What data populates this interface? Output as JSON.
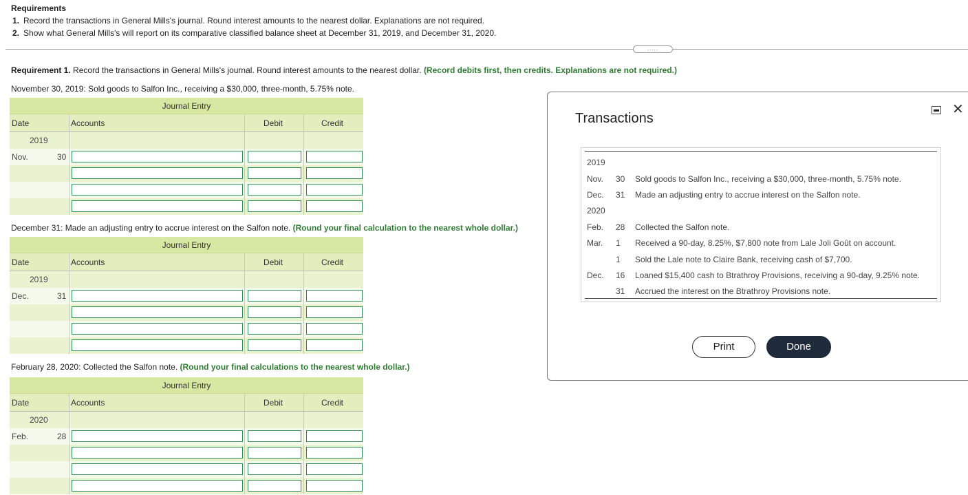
{
  "requirements": {
    "title": "Requirements",
    "items": [
      {
        "num": "1.",
        "text": "Record the transactions in General Mills's journal. Round interest amounts to the nearest dollar. Explanations are not required."
      },
      {
        "num": "2.",
        "text": "Show what General Mills's will report on its comparative classified balance sheet at December 31, 2019, and December 31, 2020."
      }
    ]
  },
  "divider_handle": ".....",
  "requirement1": {
    "label": "Requirement 1.",
    "text": " Record the transactions in General Mills's journal. Round interest amounts to the nearest dollar. ",
    "hint": "(Record debits first, then credits. Explanations are not required.)"
  },
  "sections": [
    {
      "prompt": "November 30, 2019: Sold goods to Salfon Inc., receiving a $30,000, three-month, 5.75% note.",
      "hint": "",
      "journal_title": "Journal Entry",
      "headers": {
        "date": "Date",
        "accounts": "Accounts",
        "debit": "Debit",
        "credit": "Credit"
      },
      "year": "2019",
      "month": "Nov.",
      "day": "30"
    },
    {
      "prompt": "December 31: Made an adjusting entry to accrue interest on the Salfon note. ",
      "hint": "(Round your final calculation to the nearest whole dollar.)",
      "journal_title": "Journal Entry",
      "headers": {
        "date": "Date",
        "accounts": "Accounts",
        "debit": "Debit",
        "credit": "Credit"
      },
      "year": "2019",
      "month": "Dec.",
      "day": "31"
    },
    {
      "prompt": "February 28, 2020: Collected the Salfon note. ",
      "hint": "(Round your final calculations to the nearest whole dollar.)",
      "journal_title": "Journal Entry",
      "headers": {
        "date": "Date",
        "accounts": "Accounts",
        "debit": "Debit",
        "credit": "Credit"
      },
      "year": "2020",
      "month": "Feb.",
      "day": "28"
    }
  ],
  "modal": {
    "title": "Transactions",
    "rows": [
      {
        "year": "2019",
        "month": "",
        "day": "",
        "text": ""
      },
      {
        "year": "",
        "month": "Nov.",
        "day": "30",
        "text": "Sold goods to Salfon Inc., receiving a $30,000, three-month, 5.75% note."
      },
      {
        "year": "",
        "month": "Dec.",
        "day": "31",
        "text": "Made an adjusting entry to accrue interest on the Salfon note."
      },
      {
        "year": "2020",
        "month": "",
        "day": "",
        "text": ""
      },
      {
        "year": "",
        "month": "Feb.",
        "day": "28",
        "text": "Collected the Salfon note."
      },
      {
        "year": "",
        "month": "Mar.",
        "day": "1",
        "text": "Received a 90-day, 8.25%, $7,800 note from Lale Joli Goût on account."
      },
      {
        "year": "",
        "month": "",
        "day": "1",
        "text": "Sold the Lale note to Claire Bank, receiving cash of $7,700."
      },
      {
        "year": "",
        "month": "Dec.",
        "day": "16",
        "text": "Loaned $15,400 cash to Btrathroy Provisions, receiving a 90-day, 9.25% note."
      },
      {
        "year": "",
        "month": "",
        "day": "31",
        "text": "Accrued the interest on the Btrathroy Provisions note."
      }
    ],
    "print_label": "Print",
    "done_label": "Done",
    "close_glyph": "✕"
  }
}
